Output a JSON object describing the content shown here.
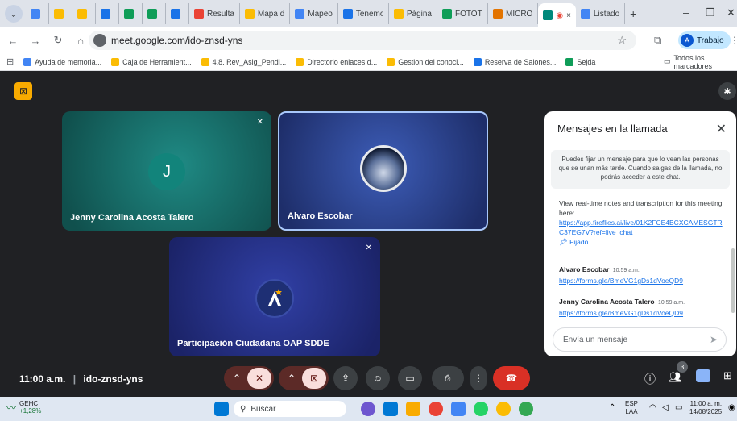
{
  "browser": {
    "tabs": [
      {
        "label": "",
        "color": "#4285f4"
      },
      {
        "label": "",
        "color": "#fbbc04"
      },
      {
        "label": "",
        "color": "#fbbc04"
      },
      {
        "label": "",
        "color": "#1a73e8"
      },
      {
        "label": "",
        "color": "#0f9d58"
      },
      {
        "label": "",
        "color": "#0f9d58"
      },
      {
        "label": "",
        "color": "#1a73e8"
      },
      {
        "label": "Resulta",
        "color": "#ea4335"
      },
      {
        "label": "Mapa d",
        "color": "#fbbc04"
      },
      {
        "label": "Mapeo",
        "color": "#4285f4"
      },
      {
        "label": "Tenemo",
        "color": "#1a73e8"
      },
      {
        "label": "Página",
        "color": "#fbbc04"
      },
      {
        "label": "FOTOTI",
        "color": "#0f9d58"
      },
      {
        "label": "MICRO",
        "color": "#e37400"
      }
    ],
    "active_tab_close": "×",
    "listado_tab": "Listado",
    "new_tab": "+",
    "url": "meet.google.com/ido-znsd-yns",
    "profile": "Trabajo",
    "profile_initial": "A",
    "bookmarks": [
      {
        "label": "Ayuda de memoria...",
        "color": "#4285f4"
      },
      {
        "label": "Caja de Herramient...",
        "color": "#fbbc04"
      },
      {
        "label": "4.8. Rev_Asig_Pendi...",
        "color": "#fbbc04"
      },
      {
        "label": "Directorio enlaces d...",
        "color": "#fbbc04"
      },
      {
        "label": "Gestion del conoci...",
        "color": "#fbbc04"
      },
      {
        "label": "Reserva de Salones...",
        "color": "#1a73e8"
      },
      {
        "label": "Sejda",
        "color": "#0f9d58"
      }
    ],
    "all_bookmarks": "Todos los marcadores"
  },
  "meet": {
    "participants": [
      {
        "name": "Jenny Carolina Acosta Talero",
        "initial": "J"
      },
      {
        "name": "Alvaro Escobar"
      },
      {
        "name": "Participación Ciudadana OAP SDDE"
      }
    ],
    "meeting_time": "11:00 a.m.",
    "meeting_code": "ido-znsd-yns",
    "people_count": "3"
  },
  "chat": {
    "title": "Mensajes en la llamada",
    "pin_note": "Puedes fijar un mensaje para que lo vean las personas que se unan más tarde. Cuando salgas de la llamada, no podrás acceder a este chat.",
    "pinned_text": "View real-time notes and transcription for this meeting here:",
    "pinned_link": "https://app.fireflies.ai/live/01K2FCE4BCXCAMESGTRC37EG7V?ref=live_chat",
    "pinned_label": "Fijado",
    "messages": [
      {
        "sender": "Alvaro Escobar",
        "time": "10:59 a.m.",
        "link": "https://forms.gle/BmeVG1gDs1dVoeQD9"
      },
      {
        "sender": "Jenny Carolina Acosta Talero",
        "time": "10:59 a.m.",
        "link": "https://forms.gle/BmeVG1gDs1dVoeQD9"
      }
    ],
    "input_placeholder": "Envía un mensaje"
  },
  "taskbar": {
    "ticker": "GEHC",
    "ticker_change": "+1,28%",
    "search": "Buscar",
    "lang_1": "ESP",
    "lang_2": "LAA",
    "clock_time": "11:00 a. m.",
    "clock_date": "14/08/2025"
  }
}
